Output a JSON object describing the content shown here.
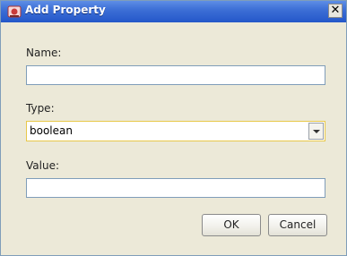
{
  "window": {
    "title": "Add Property",
    "close_glyph": "✕"
  },
  "form": {
    "name_label": "Name:",
    "name_value": "",
    "type_label": "Type:",
    "type_value": "boolean",
    "value_label": "Value:",
    "value_value": ""
  },
  "buttons": {
    "ok": "OK",
    "cancel": "Cancel"
  },
  "icons": {
    "title_icon": "app-icon",
    "dropdown": "chevron-down-icon"
  },
  "colors": {
    "titlebar": "#2457c9",
    "panel": "#ece9d8",
    "focus_border": "#e8c84a"
  }
}
